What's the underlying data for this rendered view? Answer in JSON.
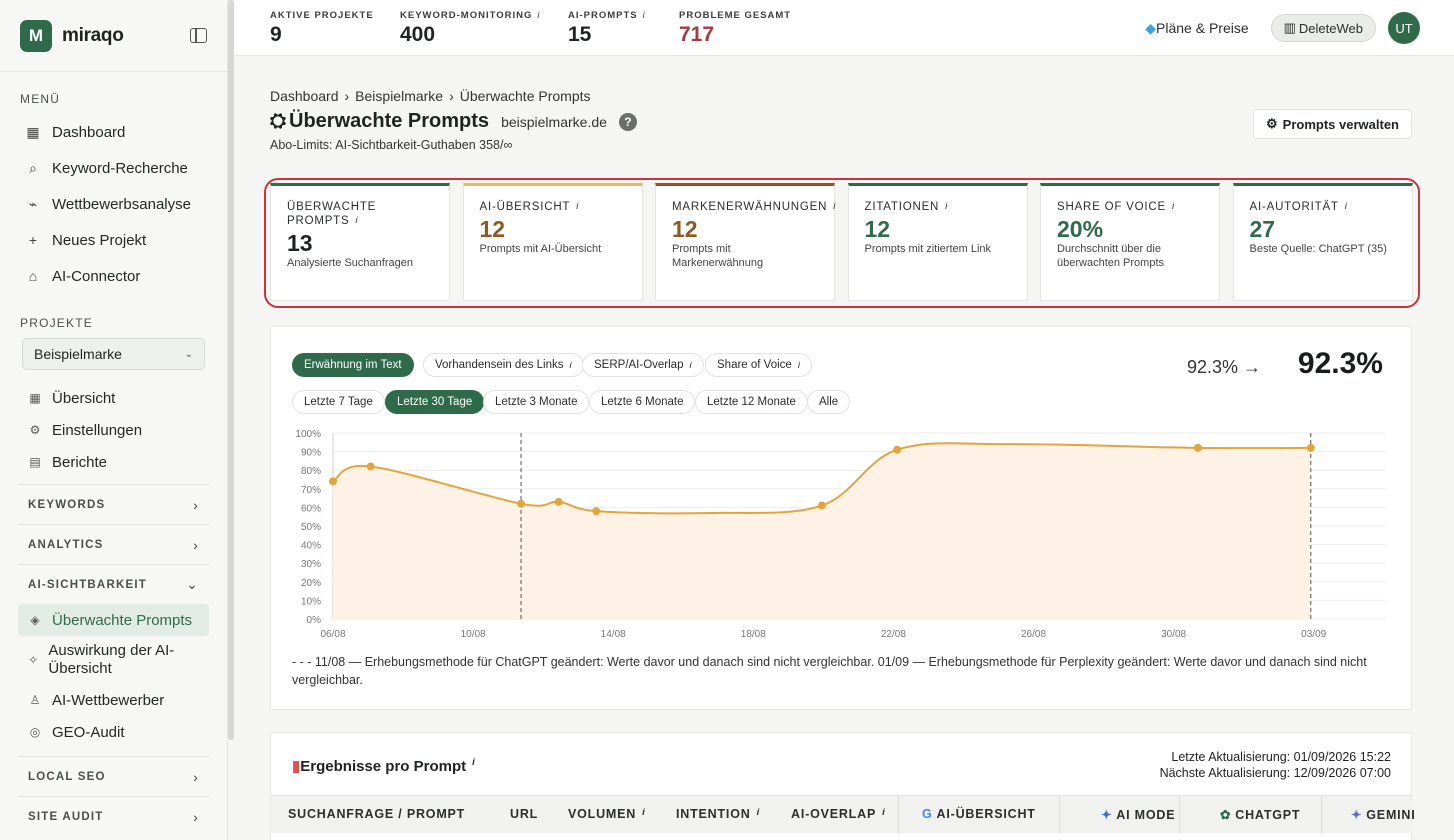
{
  "brand": {
    "name": "miraqo",
    "logo_letter": "M"
  },
  "sidebar": {
    "menu_label": "MENÜ",
    "menu": [
      {
        "icon": "dashboard-icon",
        "glyph": "▦",
        "label": "Dashboard"
      },
      {
        "icon": "search-icon",
        "glyph": "⌕",
        "label": "Keyword-Recherche"
      },
      {
        "icon": "chart-icon",
        "glyph": "⌁",
        "label": "Wettbewerbsanalyse"
      },
      {
        "icon": "plus-icon",
        "glyph": "+",
        "label": "Neues Projekt"
      },
      {
        "icon": "robot-icon",
        "glyph": "⌂",
        "label": "AI-Connector"
      }
    ],
    "projects_label": "PROJEKTE",
    "project_selected": "Beispielmarke",
    "project_items": [
      {
        "icon": "grid-icon",
        "glyph": "▦",
        "label": "Übersicht"
      },
      {
        "icon": "gear-icon",
        "glyph": "⚙",
        "label": "Einstellungen"
      },
      {
        "icon": "document-icon",
        "glyph": "▤",
        "label": "Berichte"
      }
    ],
    "groups": {
      "keywords": "KEYWORDS",
      "analytics": "ANALYTICS",
      "ai_visibility": "AI-SICHTBARKEIT",
      "local_seo": "LOCAL SEO",
      "site_audit": "SITE AUDIT"
    },
    "ai_items": [
      {
        "icon": "layers-icon",
        "glyph": "◈",
        "label": "Überwachte Prompts"
      },
      {
        "icon": "sparkle-icon",
        "glyph": "✧",
        "label": "Auswirkung der AI-Übersicht"
      },
      {
        "icon": "user-icon",
        "glyph": "♙",
        "label": "AI-Wettbewerber"
      },
      {
        "icon": "compass-icon",
        "glyph": "◎",
        "label": "GEO-Audit"
      }
    ]
  },
  "topbar": {
    "stats": [
      {
        "label": "AKTIVE PROJEKTE",
        "value": "9",
        "info": "",
        "color": "#1f2421"
      },
      {
        "label": "KEYWORD-MONITORING",
        "value": "400",
        "info": "i",
        "color": "#1f2421"
      },
      {
        "label": "AI-PROMPTS",
        "value": "15",
        "info": "i",
        "color": "#1f2421"
      },
      {
        "label": "PROBLEME GESAMT",
        "value": "717",
        "info": "",
        "color": "#a3393c"
      }
    ],
    "plans_label": "Pläne & Preise",
    "deleteweb_label": "DeleteWeb",
    "avatar_initials": "UT"
  },
  "page": {
    "breadcrumb": [
      "Dashboard",
      "Beispielmarke",
      "Überwachte Prompts"
    ],
    "title": "Überwachte Prompts",
    "domain": "beispielmarke.de",
    "abo_limits": "Abo-Limits: AI-Sichtbarkeit-Guthaben 358/∞",
    "manage_button": "Prompts verwalten"
  },
  "kpis": [
    {
      "label": "ÜBERWACHTE PROMPTS",
      "value": "13",
      "sub": "Analysierte Suchanfragen",
      "accent": "#2f6b4a",
      "value_color": "#1f2421"
    },
    {
      "label": "AI-ÜBERSICHT",
      "value": "12",
      "sub": "Prompts mit AI-Übersicht",
      "accent": "#e6bd62",
      "value_color": "#8a5a24"
    },
    {
      "label": "MARKENERWÄHNUNGEN",
      "value": "12",
      "sub": "Prompts mit Markenerwähnung",
      "accent": "#a34a2a",
      "value_color": "#8a5a24"
    },
    {
      "label": "ZITATIONEN",
      "value": "12",
      "sub": "Prompts mit zitiertem Link",
      "accent": "#2f6b4a",
      "value_color": "#2f6b4a"
    },
    {
      "label": "SHARE OF VOICE",
      "value": "20%",
      "sub": "Durchschnitt über die überwachten Prompts",
      "accent": "#2f6b4a",
      "value_color": "#2f6b4a"
    },
    {
      "label": "AI-AUTORITÄT",
      "value": "27",
      "sub": "Beste Quelle: ChatGPT (35)",
      "accent": "#2f6b4a",
      "value_color": "#2f6b4a"
    }
  ],
  "chart_tabs": [
    "Erwähnung im Text",
    "Vorhandensein des Links",
    "SERP/AI-Overlap",
    "Share of Voice"
  ],
  "time_ranges": [
    "Letzte 7 Tage",
    "Letzte 30 Tage",
    "Letzte 3 Monate",
    "Letzte 6 Monate",
    "Letzte 12 Monate",
    "Alle"
  ],
  "change": {
    "from": "92.3%",
    "to": "92.3%"
  },
  "chart_note": "- - - 11/08 — Erhebungsmethode für ChatGPT geändert: Werte davor und danach sind nicht vergleichbar. 01/09 — Erhebungsmethode für Perplexity geändert: Werte davor und danach sind nicht vergleichbar.",
  "chart_data": {
    "type": "area",
    "x_ticks": [
      "06/08",
      "10/08",
      "14/08",
      "18/08",
      "22/08",
      "26/08",
      "30/08",
      "03/09"
    ],
    "y_ticks": [
      "0%",
      "10%",
      "20%",
      "30%",
      "40%",
      "50%",
      "60%",
      "70%",
      "80%",
      "90%",
      "100%"
    ],
    "ylim": [
      0,
      100
    ],
    "xlim": [
      0,
      28
    ],
    "points": [
      {
        "x": 0,
        "y": 74
      },
      {
        "x": 1,
        "y": 82
      },
      {
        "x": 5,
        "y": 62
      },
      {
        "x": 6,
        "y": 63
      },
      {
        "x": 7,
        "y": 58
      },
      {
        "x": 13,
        "y": 61
      },
      {
        "x": 15,
        "y": 91
      },
      {
        "x": 23,
        "y": 92
      },
      {
        "x": 26,
        "y": 92
      }
    ],
    "curve_extra": [
      {
        "x": 10,
        "y": 57
      },
      {
        "x": 18,
        "y": 94
      }
    ],
    "markers": [
      5,
      26
    ],
    "color": "#e0a53f"
  },
  "results": {
    "title": "Ergebnisse pro Prompt",
    "updated": "Letzte Aktualisierung: 01/09/2026 15:22",
    "next": "Nächste Aktualisierung: 12/09/2026 07:00",
    "columns": [
      "SUCHANFRAGE / PROMPT",
      "URL",
      "VOLUMEN",
      "INTENTION",
      "AI-OVERLAP",
      "AI-ÜBERSICHT",
      "AI MODE",
      "CHATGPT",
      "GEMINI"
    ]
  }
}
